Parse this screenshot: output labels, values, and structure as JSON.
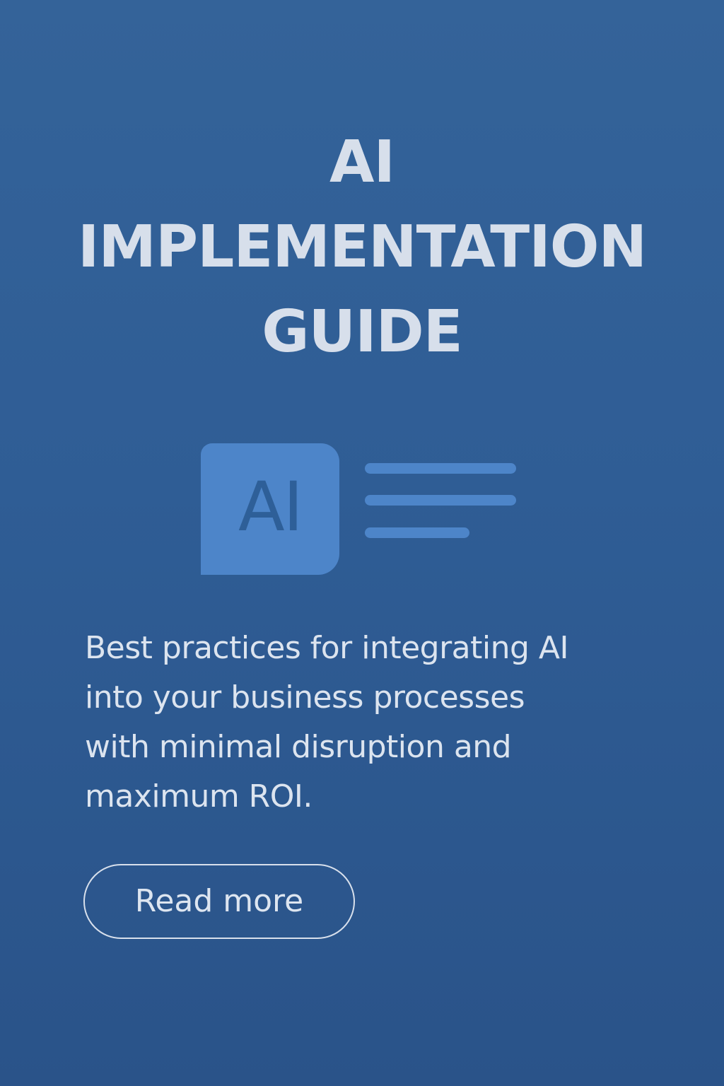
{
  "title": {
    "lines": [
      "AI",
      "IMPLEMENTATION",
      "GUIDE"
    ]
  },
  "icon": {
    "name": "ai-document-icon",
    "badge_text": "AI"
  },
  "description": {
    "lines": [
      "Best practices for integrating AI",
      "into your business processes",
      "with minimal disruption and",
      "maximum ROI."
    ]
  },
  "cta": {
    "label": "Read more"
  },
  "colors": {
    "background": "#2f5d95",
    "title_text": "#d7dfeb",
    "accent": "#4d85c9",
    "button_border": "#d8e0ec"
  }
}
